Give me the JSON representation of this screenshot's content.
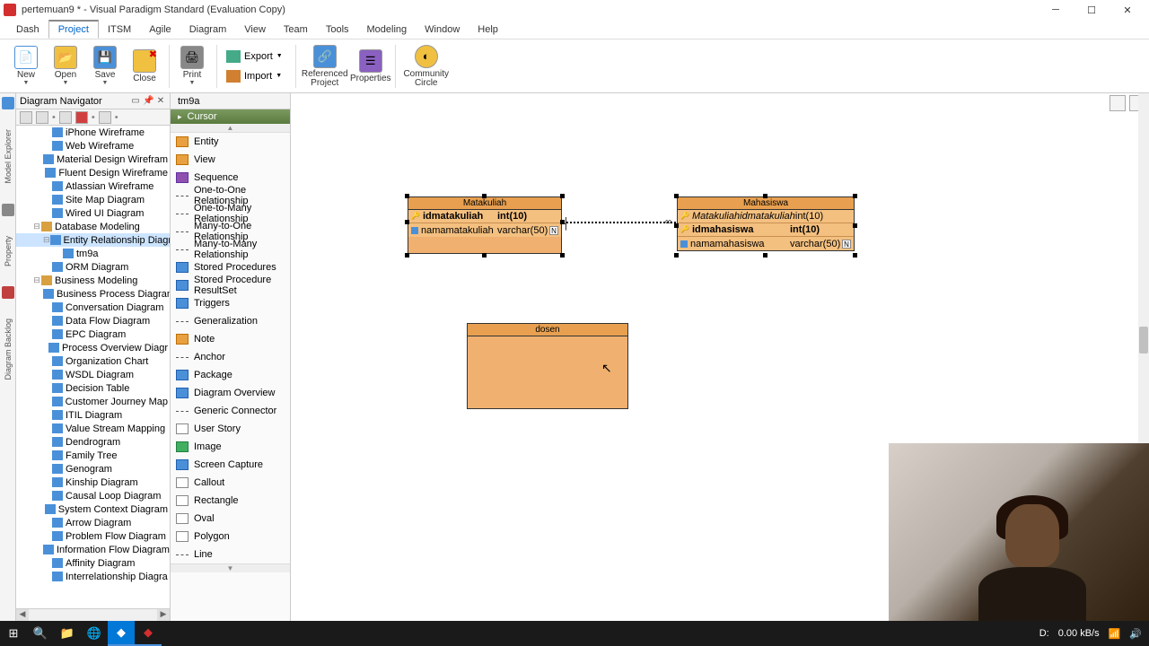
{
  "titlebar": {
    "title": "pertemuan9 * - Visual Paradigm Standard (Evaluation Copy)"
  },
  "menubar": {
    "tabs": [
      "Dash",
      "Project",
      "ITSM",
      "Agile",
      "Diagram",
      "View",
      "Team",
      "Tools",
      "Modeling",
      "Window",
      "Help"
    ],
    "active_index": 1
  },
  "ribbon": {
    "buttons": [
      {
        "label": "New",
        "dropdown": true
      },
      {
        "label": "Open",
        "dropdown": true
      },
      {
        "label": "Save",
        "dropdown": true
      },
      {
        "label": "Close"
      },
      {
        "label": "Print",
        "dropdown": true
      },
      {
        "label": "Referenced\nProject"
      },
      {
        "label": "Properties"
      },
      {
        "label": "Community\nCircle"
      }
    ],
    "export_label": "Export",
    "import_label": "Import"
  },
  "navigator": {
    "title": "Diagram Navigator",
    "tree": [
      {
        "level": 2,
        "label": "iPhone Wireframe"
      },
      {
        "level": 2,
        "label": "Web Wireframe"
      },
      {
        "level": 2,
        "label": "Material Design Wirefram"
      },
      {
        "level": 2,
        "label": "Fluent Design Wireframe"
      },
      {
        "level": 2,
        "label": "Atlassian Wireframe"
      },
      {
        "level": 2,
        "label": "Site Map Diagram"
      },
      {
        "level": 2,
        "label": "Wired UI Diagram"
      },
      {
        "level": 1,
        "label": "Database Modeling",
        "folder": true,
        "expanded": true
      },
      {
        "level": 2,
        "label": "Entity Relationship Diagr",
        "selected": true,
        "expanded": true
      },
      {
        "level": 3,
        "label": "tm9a"
      },
      {
        "level": 2,
        "label": "ORM Diagram"
      },
      {
        "level": 1,
        "label": "Business Modeling",
        "folder": true,
        "expanded": true
      },
      {
        "level": 2,
        "label": "Business Process Diagram"
      },
      {
        "level": 2,
        "label": "Conversation Diagram"
      },
      {
        "level": 2,
        "label": "Data Flow Diagram"
      },
      {
        "level": 2,
        "label": "EPC Diagram"
      },
      {
        "level": 2,
        "label": "Process Overview Diagr"
      },
      {
        "level": 2,
        "label": "Organization Chart"
      },
      {
        "level": 2,
        "label": "WSDL Diagram"
      },
      {
        "level": 2,
        "label": "Decision Table"
      },
      {
        "level": 2,
        "label": "Customer Journey Map"
      },
      {
        "level": 2,
        "label": "ITIL Diagram"
      },
      {
        "level": 2,
        "label": "Value Stream Mapping"
      },
      {
        "level": 2,
        "label": "Dendrogram"
      },
      {
        "level": 2,
        "label": "Family Tree"
      },
      {
        "level": 2,
        "label": "Genogram"
      },
      {
        "level": 2,
        "label": "Kinship Diagram"
      },
      {
        "level": 2,
        "label": "Causal Loop Diagram"
      },
      {
        "level": 2,
        "label": "System Context Diagram"
      },
      {
        "level": 2,
        "label": "Arrow Diagram"
      },
      {
        "level": 2,
        "label": "Problem Flow Diagram"
      },
      {
        "level": 2,
        "label": "Information Flow Diagram"
      },
      {
        "level": 2,
        "label": "Affinity Diagram"
      },
      {
        "level": 2,
        "label": "Interrelationship Diagra"
      }
    ]
  },
  "canvas_tab": "tm9a",
  "palette": {
    "cursor": "Cursor",
    "items": [
      {
        "label": "Entity",
        "cls": ""
      },
      {
        "label": "View",
        "cls": ""
      },
      {
        "label": "Sequence",
        "cls": "purple"
      },
      {
        "label": "One-to-One Relationship",
        "cls": "line"
      },
      {
        "label": "One-to-Many Relationship",
        "cls": "line"
      },
      {
        "label": "Many-to-One Relationship",
        "cls": "line"
      },
      {
        "label": "Many-to-Many Relationship",
        "cls": "line"
      },
      {
        "label": "Stored Procedures",
        "cls": "blue"
      },
      {
        "label": "Stored Procedure ResultSet",
        "cls": "blue"
      },
      {
        "label": "Triggers",
        "cls": "blue"
      },
      {
        "label": "Generalization",
        "cls": "line"
      },
      {
        "label": "Note",
        "cls": ""
      },
      {
        "label": "Anchor",
        "cls": "line"
      },
      {
        "label": "Package",
        "cls": "blue"
      },
      {
        "label": "Diagram Overview",
        "cls": "blue"
      },
      {
        "label": "Generic Connector",
        "cls": "line"
      },
      {
        "label": "User Story",
        "cls": "shape"
      },
      {
        "label": "Image",
        "cls": "green"
      },
      {
        "label": "Screen Capture",
        "cls": "blue"
      },
      {
        "label": "Callout",
        "cls": "shape"
      },
      {
        "label": "Rectangle",
        "cls": "shape"
      },
      {
        "label": "Oval",
        "cls": "shape"
      },
      {
        "label": "Polygon",
        "cls": "shape"
      },
      {
        "label": "Line",
        "cls": "line"
      }
    ]
  },
  "entities": {
    "matakuliah": {
      "name": "Matakuliah",
      "rows": [
        {
          "key": "PK",
          "name": "idmatakuliah",
          "type": "int(10)",
          "null": ""
        },
        {
          "key": "",
          "name": "namamatakuliah",
          "type": "varchar(50)",
          "null": "N"
        }
      ]
    },
    "mahasiswa": {
      "name": "Mahasiswa",
      "rows": [
        {
          "key": "FK",
          "name": "Matakuliahidmatakuliah",
          "type": "int(10)",
          "null": "",
          "italic": true
        },
        {
          "key": "PK",
          "name": "idmahasiswa",
          "type": "int(10)",
          "null": ""
        },
        {
          "key": "",
          "name": "namamahasiswa",
          "type": "varchar(50)",
          "null": "N"
        }
      ]
    },
    "dosen": {
      "name": "dosen"
    }
  },
  "leftbar": {
    "tabs": [
      "Model Explorer",
      "Property",
      "Diagram Backlog"
    ]
  },
  "taskbar": {
    "net_speed": "0.00 kB/s",
    "drive": "D:"
  }
}
